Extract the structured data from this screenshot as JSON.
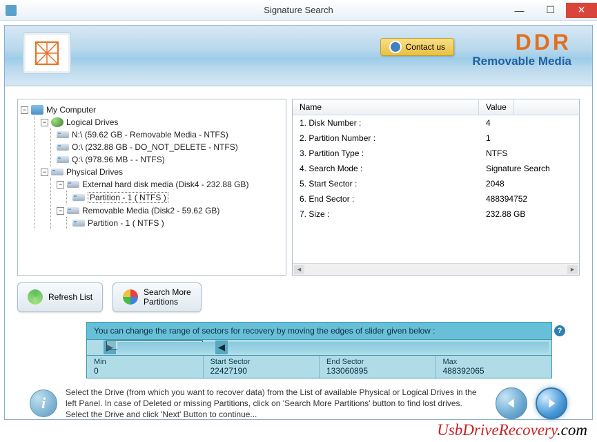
{
  "window": {
    "title": "Signature Search"
  },
  "banner": {
    "contact_label": "Contact us",
    "brand": "DDR",
    "brand_sub": "Removable Media"
  },
  "tree": {
    "root": "My Computer",
    "logical_label": "Logical Drives",
    "logical": [
      "N:\\ (59.62 GB - Removable Media - NTFS)",
      "O:\\ (232.88 GB - DO_NOT_DELETE - NTFS)",
      "Q:\\ (978.96 MB -  - NTFS)"
    ],
    "physical_label": "Physical Drives",
    "physical": [
      {
        "label": "External hard disk media (Disk4 - 232.88 GB)",
        "partitions": [
          "Partition - 1 ( NTFS )"
        ]
      },
      {
        "label": "Removable Media (Disk2 - 59.62 GB)",
        "partitions": [
          "Partition - 1 ( NTFS )"
        ]
      }
    ]
  },
  "grid": {
    "col_name": "Name",
    "col_value": "Value",
    "rows": [
      {
        "name": "1. Disk Number :",
        "value": "4"
      },
      {
        "name": "2. Partition Number :",
        "value": "1"
      },
      {
        "name": "3. Partition Type :",
        "value": "NTFS"
      },
      {
        "name": "4. Search Mode :",
        "value": "Signature Search"
      },
      {
        "name": "5. Start Sector :",
        "value": "2048"
      },
      {
        "name": "6. End Sector :",
        "value": "488394752"
      },
      {
        "name": "7. Size :",
        "value": "232.88 GB"
      }
    ]
  },
  "buttons": {
    "refresh": "Refresh List",
    "search_more": "Search More\nPartitions"
  },
  "sector": {
    "hint": "You can change the range of sectors for recovery by moving the edges of slider given below :",
    "min_label": "Min",
    "min": "0",
    "start_label": "Start Sector",
    "start": "22427190",
    "end_label": "End Sector",
    "end": "133060895",
    "max_label": "Max",
    "max": "488392065"
  },
  "footer": {
    "text": "Select the Drive (from which you want to recover data) from the List of available Physical or Logical Drives in the left Panel. In case of Deleted or missing Partitions, click on 'Search More Partitions' button to find lost drives. Select the Drive and click 'Next' Button to continue..."
  },
  "watermark": {
    "a": "UsbDriveRecovery",
    "b": ".com"
  }
}
